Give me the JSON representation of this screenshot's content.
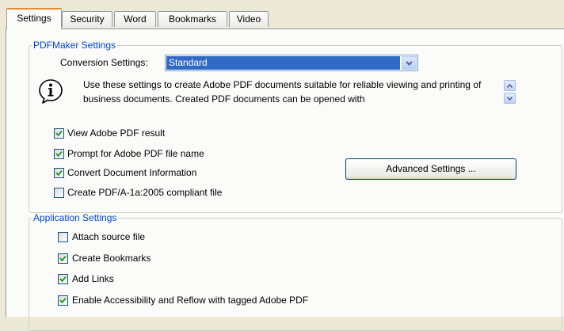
{
  "tabs": [
    {
      "label": "Settings",
      "active": true
    },
    {
      "label": "Security",
      "active": false
    },
    {
      "label": "Word",
      "active": false
    },
    {
      "label": "Bookmarks",
      "active": false
    },
    {
      "label": "Video",
      "active": false
    }
  ],
  "pdfmaker": {
    "legend": "PDFMaker Settings",
    "conversion_label": "Conversion Settings:",
    "conversion_value": "Standard",
    "description": "Use these settings to create Adobe PDF documents suitable for reliable viewing and printing of business documents.  Created PDF documents can be opened with",
    "options": [
      {
        "label": "View Adobe PDF result",
        "checked": true
      },
      {
        "label": "Prompt for Adobe PDF file name",
        "checked": true
      },
      {
        "label": "Convert Document Information",
        "checked": true
      },
      {
        "label": "Create PDF/A-1a:2005 compliant file",
        "checked": false
      }
    ],
    "advanced_button": "Advanced Settings ..."
  },
  "application": {
    "legend": "Application Settings",
    "options": [
      {
        "label": "Attach source file",
        "checked": false
      },
      {
        "label": "Create Bookmarks",
        "checked": true
      },
      {
        "label": "Add Links",
        "checked": true
      },
      {
        "label": "Enable Accessibility and Reflow with tagged Adobe PDF",
        "checked": true
      }
    ]
  },
  "colors": {
    "accent_tab": "#e68b2c",
    "legend_text": "#0046d5",
    "selection": "#316ac5",
    "check": "#21a121"
  }
}
